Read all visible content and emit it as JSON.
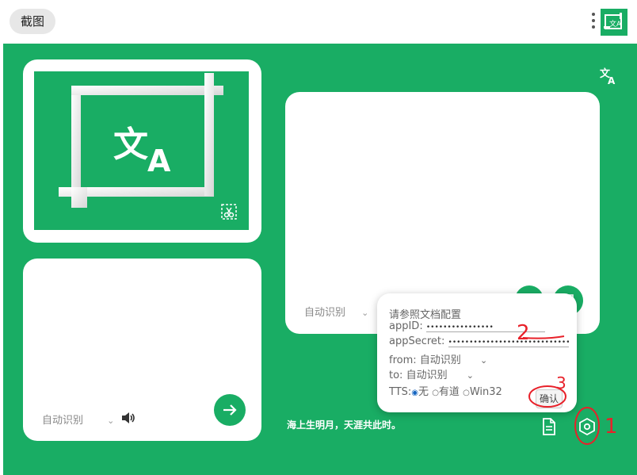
{
  "topbar": {
    "tab_label": "截图"
  },
  "settings_popup": {
    "title": "请参照文档配置",
    "appid_label": "appID:",
    "appid_value": "••••••••••••••••",
    "appsecret_label": "appSecret:",
    "appsecret_value": "••••••••••••••••••••••••••••••••",
    "from_label": "from:",
    "from_value": "自动识别",
    "to_label": "to:",
    "to_value": "自动识别",
    "tts_label": "TTS:",
    "tts_options": [
      "无",
      "有道",
      "Win32"
    ],
    "tts_selected": "无",
    "confirm_label": "确认"
  },
  "source_panel": {
    "lang_value": "自动识别"
  },
  "target_panel": {
    "lang_value": "自动识别"
  },
  "footer": {
    "poem": "海上生明月，天涯共此时。"
  },
  "annotations": [
    "1",
    "2",
    "3"
  ],
  "colors": {
    "accent": "#19ad64",
    "annotation": "#e8212a"
  },
  "icons": [
    "more-vert-icon",
    "app-logo-icon",
    "translate-icon",
    "screenshot-crop-icon",
    "scissors-icon",
    "speaker-icon",
    "arrow-right-icon",
    "document-icon",
    "settings-hex-icon",
    "chevron-down-icon",
    "copy-icon"
  ]
}
